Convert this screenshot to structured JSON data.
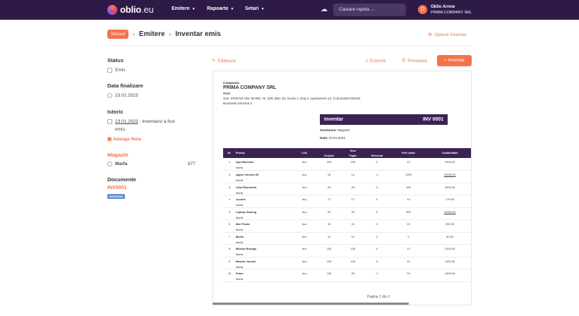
{
  "nav": {
    "logo_main": "oblio",
    "logo_suffix": ".eu",
    "items": [
      {
        "label": "Emitere"
      },
      {
        "label": "Rapoarte"
      },
      {
        "label": "Setari"
      }
    ],
    "search_placeholder": "Cautare rapida ...",
    "user_initial": "O",
    "user_name": "Oblio Arrow",
    "user_company": "PRIMA COMPANY SRL"
  },
  "breadcrumb": {
    "badge": "Stocuri",
    "items": [
      "Emitere",
      "Inventar emis"
    ],
    "options_label": "Optiuni Inventar"
  },
  "sidebar": {
    "status_title": "Status",
    "status_value": "Emis",
    "date_title": "Data finalizare",
    "date_value": "23.01.2023",
    "history_title": "Istoric",
    "history_date": "23.01.2023",
    "history_text": " - Inventarul a fost",
    "history_text2": "emis.",
    "add_note": "Adauga Nota",
    "warehouse_title": "Magazin",
    "warehouse_name": "Marfa",
    "warehouse_count": "877",
    "documents_title": "Documente",
    "document_number": "INV0001",
    "document_badge": "INVENTAR"
  },
  "actions": {
    "edit": "Editeaza",
    "export": "Exporta",
    "print": "Printeaza",
    "new": "+ Inventar"
  },
  "document": {
    "company_label": "Compania:",
    "company_name": "PRIMA COMPANY SRL",
    "company_code": "8586",
    "company_address": "Sos. STEFAN CEL MARE, Nr. 228, Bloc 45, Scara 1, Etaj 4, Apartament 14, Cod postal 020162",
    "company_city": "Bucuresti Sectorul 2",
    "title": "Inventar",
    "number": "INV 0001",
    "gestiune_label": "Gestiunea:",
    "gestiune_value": "Magazin",
    "data_label": "Data:",
    "data_value": "23.01.2023",
    "columns": {
      "nr": "Nr.",
      "produs": "Produs",
      "um": "U.M.",
      "stoc": "Stoc",
      "scriptic": "Scriptic",
      "faptic": "Faptic",
      "diferenta": "Diferenta",
      "pret": "Pret unitar",
      "contabilitate": "Contabilitate"
    },
    "rows": [
      {
        "nr": "1",
        "name": "Apa Minerala",
        "cat": "Marfa",
        "um": "buc",
        "scriptic": "200",
        "faptic": "200",
        "dif": "0",
        "pret": "10",
        "total": "2000.00",
        "u": false
      },
      {
        "nr": "2",
        "name": "Apple Cinema 30",
        "cat": "Marfa",
        "um": "buc",
        "scriptic": "15",
        "faptic": "14",
        "dif": "-1",
        "pret": "1000",
        "total": "15000.00",
        "u": true
      },
      {
        "nr": "3",
        "name": "Casti Bluetooth",
        "cat": "Marfa",
        "um": "buc",
        "scriptic": "20",
        "faptic": "20",
        "dif": "0",
        "pret": "200",
        "total": "4000.00",
        "u": false
      },
      {
        "nr": "4",
        "name": "Jucarie",
        "cat": "Marfa",
        "um": "buc",
        "scriptic": "17",
        "faptic": "17",
        "dif": "0",
        "pret": "10",
        "total": "170.00",
        "u": false
      },
      {
        "nr": "5",
        "name": "Laptop Gaming",
        "cat": "Marfa",
        "um": "buc",
        "scriptic": "20",
        "faptic": "20",
        "dif": "0",
        "pret": "500",
        "total": "10000.00",
        "u": true
      },
      {
        "nr": "6",
        "name": "Mar Finals",
        "cat": "Marfa",
        "um": "buc",
        "scriptic": "15",
        "faptic": "15",
        "dif": "0",
        "pret": "20",
        "total": "300.00",
        "u": false
      },
      {
        "nr": "7",
        "name": "Morfa",
        "cat": "Marfa",
        "um": "buc",
        "scriptic": "10",
        "faptic": "10",
        "dif": "0",
        "pret": "5",
        "total": "50.00",
        "u": false
      },
      {
        "nr": "8",
        "name": "Masina Bonage",
        "cat": "Marfa",
        "um": "buc",
        "scriptic": "100",
        "faptic": "100",
        "dif": "0",
        "pret": "12",
        "total": "1200.00",
        "u": false
      },
      {
        "nr": "9",
        "name": "Masina Jucarie",
        "cat": "Marfa",
        "um": "buc",
        "scriptic": "100",
        "faptic": "100",
        "dif": "0",
        "pret": "11",
        "total": "1100.00",
        "u": false
      },
      {
        "nr": "10",
        "name": "Paine",
        "cat": "Marfa",
        "um": "buc",
        "scriptic": "100",
        "faptic": "99",
        "dif": "-1",
        "pret": "24",
        "total": "2400.00",
        "u": false
      }
    ],
    "pager": "Pagina 1 din 2"
  },
  "colors": {
    "topbar": "#2e1a47",
    "accent": "#f5734b",
    "table_header": "#3a2354",
    "badge": "#5b8fd6"
  }
}
